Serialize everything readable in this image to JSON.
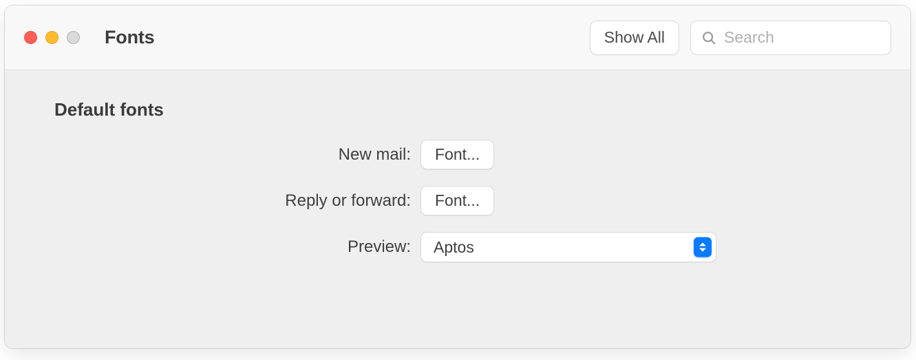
{
  "window": {
    "title": "Fonts"
  },
  "toolbar": {
    "show_all_label": "Show All",
    "search_placeholder": "Search"
  },
  "content": {
    "section_title": "Default fonts",
    "rows": {
      "new_mail": {
        "label": "New mail:",
        "button": "Font..."
      },
      "reply_forward": {
        "label": "Reply or forward:",
        "button": "Font..."
      },
      "preview": {
        "label": "Preview:",
        "value": "Aptos"
      }
    }
  }
}
